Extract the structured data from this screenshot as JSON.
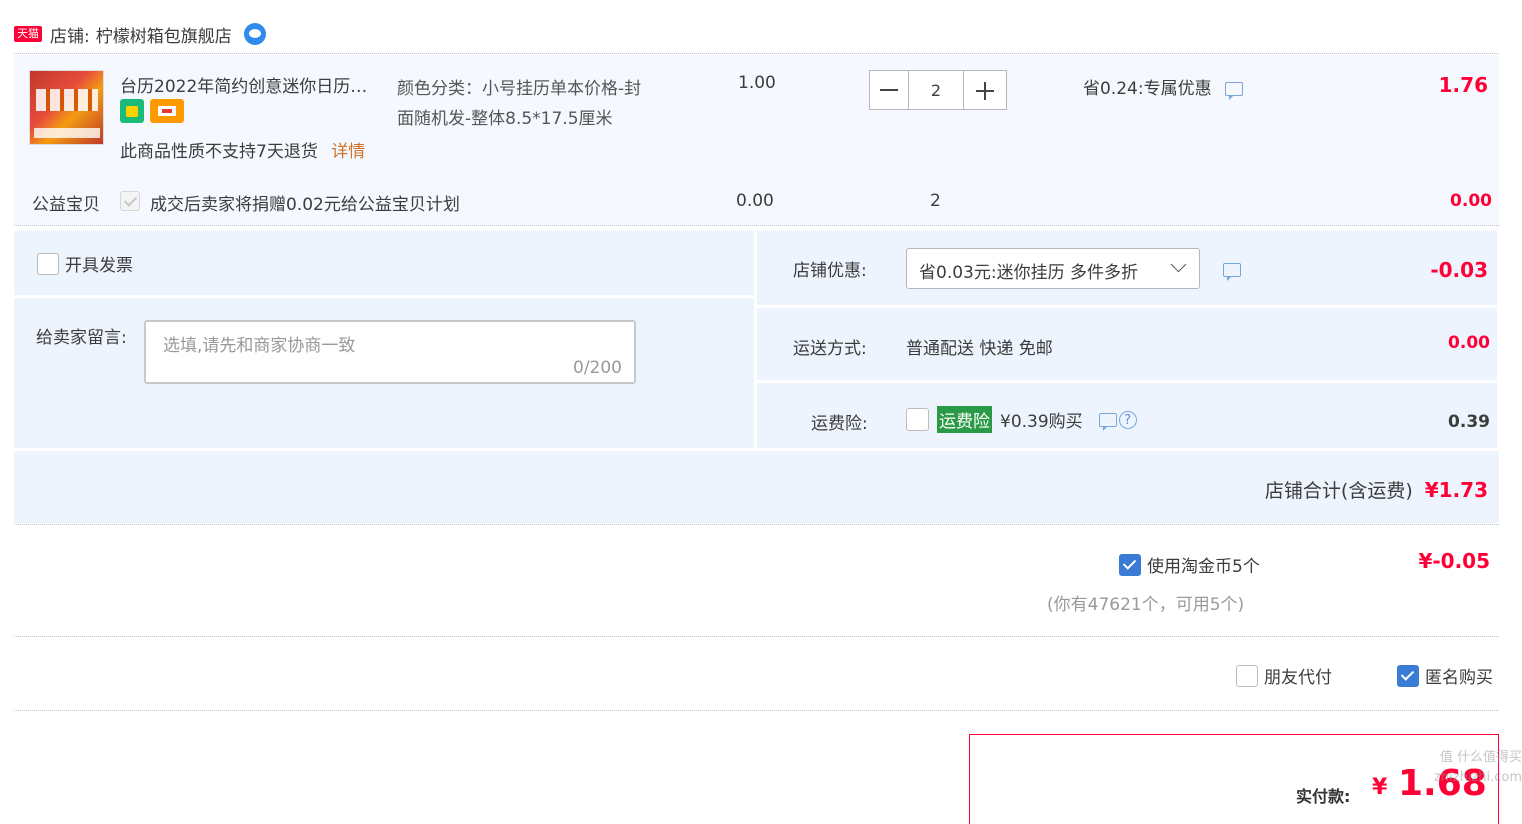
{
  "shop": {
    "badge": "天猫",
    "label": "店铺:",
    "name": "柠檬树箱包旗舰店"
  },
  "item": {
    "title": "台历2022年简约创意迷你日历…",
    "spec": "颜色分类：小号挂历单本价格-封面随机发-整体8.5*17.5厘米",
    "spec_line1": "颜色分类：小号挂历单本价格-封",
    "spec_line2": "面随机发-整体8.5*17.5厘米",
    "price": "1.00",
    "quantity": "2",
    "discount": "省0.24:专属优惠",
    "subtotal": "1.76",
    "return_note": "此商品性质不支持7天退货",
    "detail_link": "详情"
  },
  "charity": {
    "label": "公益宝贝",
    "text": "成交后卖家将捐赠0.02元给公益宝贝计划",
    "price": "0.00",
    "quantity": "2",
    "total": "0.00"
  },
  "invoice": {
    "label": "开具发票"
  },
  "message": {
    "label": "给卖家留言:",
    "placeholder": "选填,请先和商家协商一致",
    "counter": "0/200"
  },
  "shop_discount": {
    "label": "店铺优惠:",
    "selected": "省0.03元:迷你挂历 多件多折",
    "amount": "-0.03"
  },
  "shipping": {
    "label": "运送方式:",
    "value": "普通配送 快递 免邮",
    "amount": "0.00"
  },
  "insurance": {
    "label": "运费险:",
    "tag": "运费险",
    "price_text": "¥0.39购买",
    "amount": "0.39"
  },
  "shop_total": {
    "label": "店铺合计(含运费)",
    "amount": "¥1.73"
  },
  "coins": {
    "label": "使用淘金币5个",
    "amount": "¥-0.05",
    "note": "(你有47621个，可用5个)"
  },
  "options": {
    "friend_pay": "朋友代付",
    "anonymous": "匿名购买"
  },
  "payment": {
    "label": "实付款:",
    "currency": "¥",
    "amount": "1.68"
  },
  "watermark": "值 什么值得买 zhizhizhi.com",
  "colors": {
    "accent_red": "#ff0036",
    "panel_bg": "#f2f7ff",
    "checkbox_blue": "#3a7bd5",
    "insurance_green": "#2a9a47"
  }
}
